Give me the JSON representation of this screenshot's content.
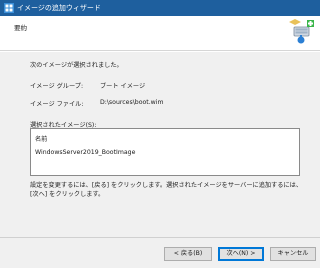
{
  "window": {
    "title": "イメージの追加ウィザード",
    "icon": "windows-server-icon"
  },
  "header": {
    "title": "要約",
    "icon": "wizard-install-icon"
  },
  "summary": {
    "intro": "次のイメージが選択されました。",
    "group_label": "イメージ グループ:",
    "group_value": "ブート イメージ",
    "file_label": "イメージ ファイル:",
    "file_value": "D:\\sources\\boot.wim",
    "selected_label": "選択されたイメージ(S):",
    "list_header": "名前",
    "list_items": [
      "WindowsServer2019_BootImage"
    ],
    "note": "設定を変更するには、[戻る] をクリックします。選択されたイメージをサーバーに追加するには、[次へ] をクリックします。"
  },
  "buttons": {
    "back": "< 戻る(B)",
    "next": "次へ(N) >",
    "cancel": "キャンセル"
  },
  "colors": {
    "titlebar": "#1e5f9e",
    "default_button_border": "#0078d7"
  }
}
